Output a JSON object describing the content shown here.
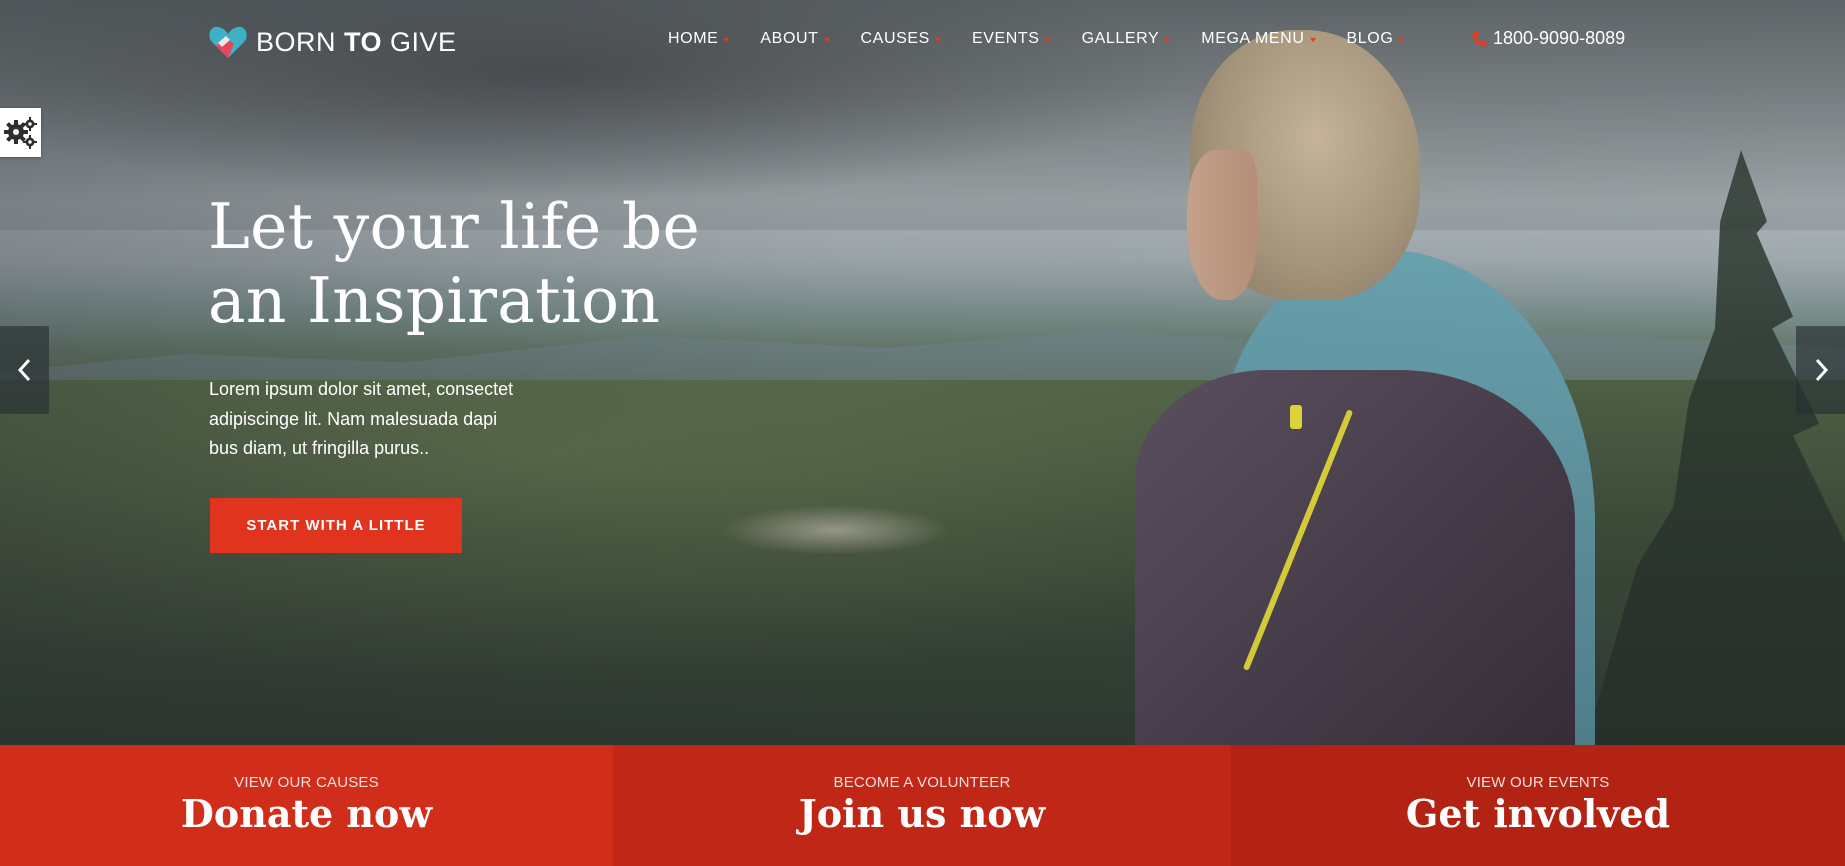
{
  "header": {
    "logo": {
      "brand_left": "BORN ",
      "brand_bold": "TO",
      "brand_right": " GIVE"
    },
    "nav": [
      {
        "label": "HOME"
      },
      {
        "label": "ABOUT"
      },
      {
        "label": "CAUSES"
      },
      {
        "label": "EVENTS"
      },
      {
        "label": "GALLERY"
      },
      {
        "label": "MEGA MENU"
      },
      {
        "label": "BLOG"
      }
    ],
    "phone": "1800-9090-8089"
  },
  "hero": {
    "title_line1": "Let your life be",
    "title_line2": "an Inspiration",
    "desc_line1": "Lorem ipsum dolor sit amet, consectet",
    "desc_line2": "adipiscinge lit. Nam malesuada dapi",
    "desc_line3": "bus diam, ut fringilla purus..",
    "cta_label": "START WITH A LITTLE"
  },
  "cta_bar": [
    {
      "kicker": "VIEW OUR CAUSES",
      "title": "Donate now"
    },
    {
      "kicker": "BECOME A VOLUNTEER",
      "title": "Join us now"
    },
    {
      "kicker": "VIEW OUR EVENTS",
      "title": "Get involved"
    }
  ],
  "colors": {
    "accent": "#e0341f",
    "bar_1": "#d02d1a",
    "bar_2": "#c12717",
    "bar_3": "#b32314"
  },
  "icons": {
    "logo": "heart-hands-icon",
    "phone": "phone-icon",
    "settings": "gears-icon",
    "prev": "chevron-left-icon",
    "next": "chevron-right-icon"
  }
}
